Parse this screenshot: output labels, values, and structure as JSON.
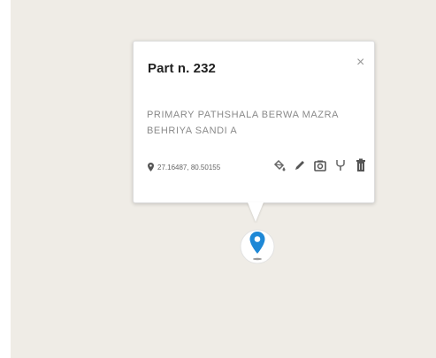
{
  "popup": {
    "title": "Part n. 232",
    "close_symbol": "×",
    "description": "PRIMARY PATHSHALA BERWA MAZRA BEHRIYA SANDI A",
    "coordinates": "27.16487, 80.50155",
    "tools": [
      {
        "icon": "paint-bucket-icon"
      },
      {
        "icon": "pencil-icon"
      },
      {
        "icon": "camera-icon"
      },
      {
        "icon": "fork-icon"
      },
      {
        "icon": "trash-icon"
      }
    ]
  },
  "colors": {
    "map_background": "#efece6",
    "marker_blue": "#1e88d6"
  }
}
